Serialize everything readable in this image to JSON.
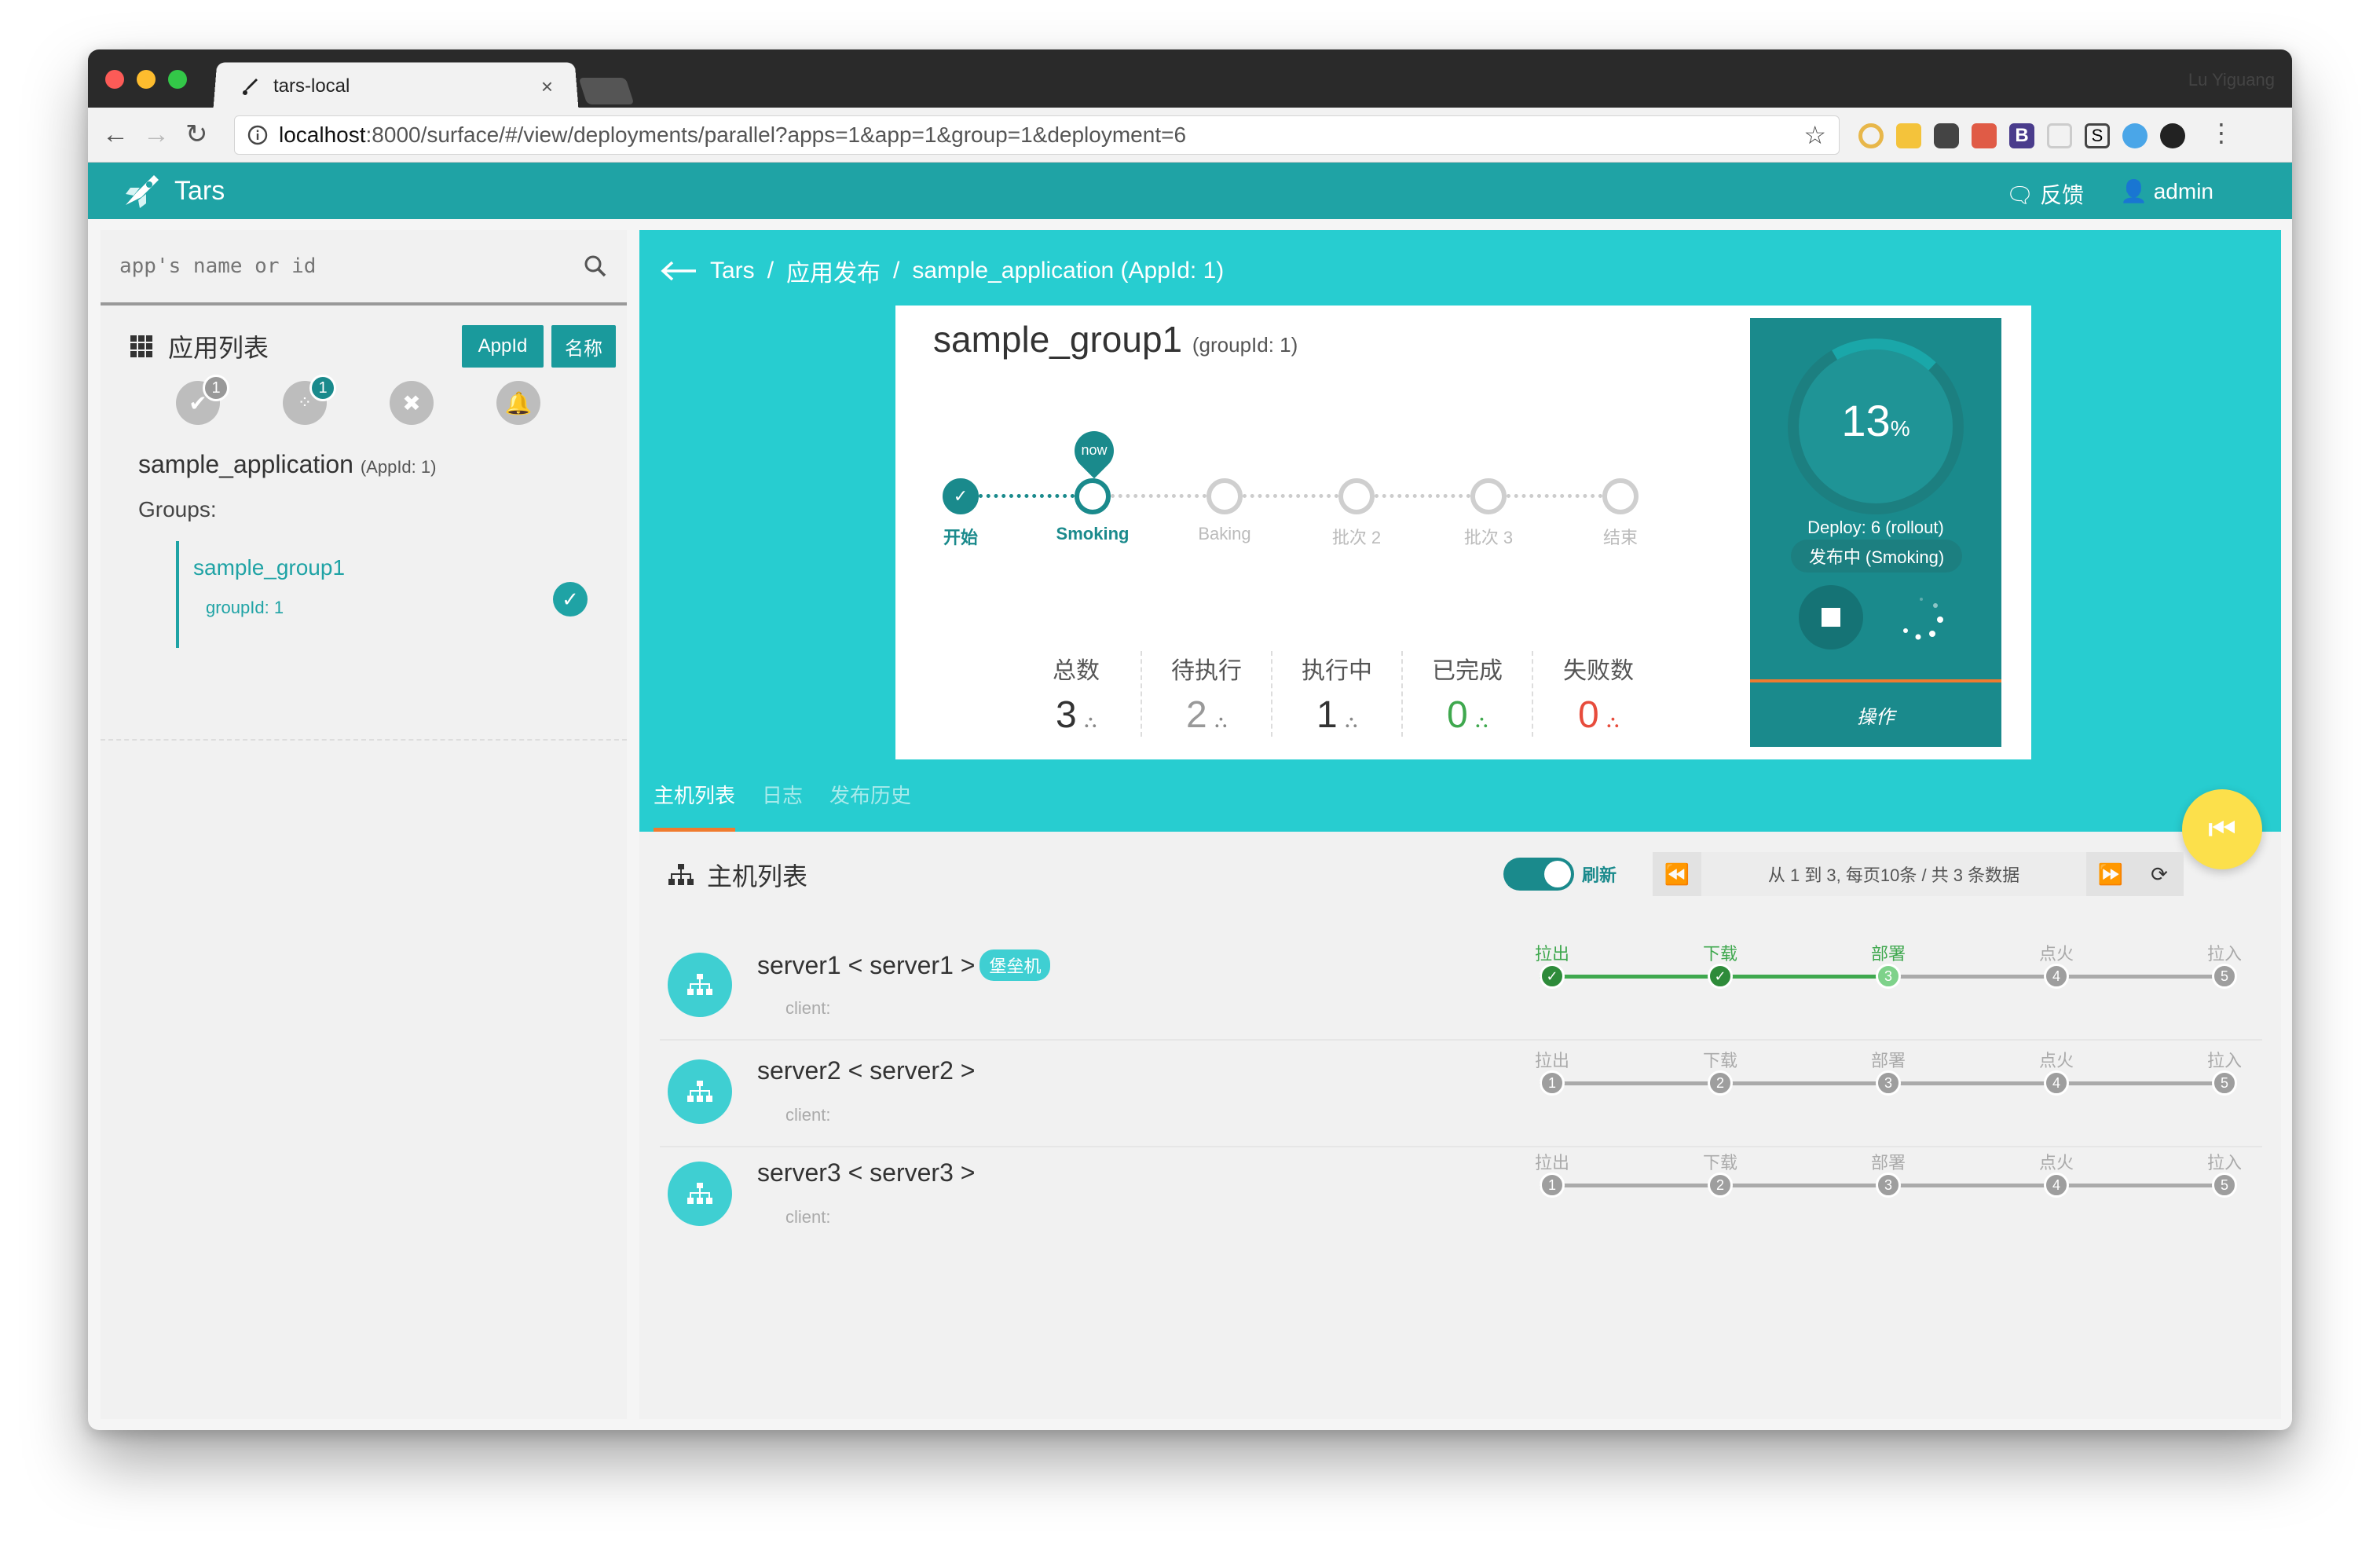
{
  "browser": {
    "tab_title": "tars-local",
    "tab_close": "×",
    "profile_name": "Lu Yiguang",
    "url_host": "localhost",
    "url_rest": ":8000/surface/#/view/deployments/parallel?apps=1&app=1&group=1&deployment=6"
  },
  "app": {
    "brand": "Tars",
    "feedback": "反馈",
    "user": "admin"
  },
  "sidebar": {
    "search_placeholder": "app's name or id",
    "list_title": "应用列表",
    "btn_appid": "AppId",
    "btn_name": "名称",
    "filters": [
      {
        "icon": "check-icon",
        "badge": "1",
        "badge_color": "#999999"
      },
      {
        "icon": "loading-icon",
        "badge": "1",
        "badge_color": "#1a8a8c"
      },
      {
        "icon": "close-icon",
        "badge": "",
        "badge_color": ""
      },
      {
        "icon": "bell-icon",
        "badge": "",
        "badge_color": ""
      }
    ],
    "app_name": "sample_application",
    "app_id_text": "(AppId: 1)",
    "groups_label": "Groups:",
    "group_name": "sample_group1",
    "group_id_text": "groupId: 1"
  },
  "breadcrumb": {
    "items": [
      "Tars",
      "/",
      "应用发布",
      "/",
      "sample_application (AppId: 1)"
    ]
  },
  "deploy_card": {
    "group_title": "sample_group1",
    "group_id_text": "(groupId: 1)",
    "now_label": "now",
    "steps": [
      "开始",
      "Smoking",
      "Baking",
      "批次 2",
      "批次 3",
      "结束"
    ],
    "stats": [
      {
        "label": "总数",
        "value": "3",
        "color": "#333333"
      },
      {
        "label": "待执行",
        "value": "2",
        "color": "#999999"
      },
      {
        "label": "执行中",
        "value": "1",
        "color": "#333333"
      },
      {
        "label": "已完成",
        "value": "0",
        "color": "#3fa84e"
      },
      {
        "label": "失败数",
        "value": "0",
        "color": "#e74c3c"
      }
    ],
    "progress_value": "13",
    "progress_unit": "%",
    "deploy_text": "Deploy: 6 (rollout)",
    "status_text": "发布中 (Smoking)",
    "operate_label": "操作"
  },
  "tabs": [
    "主机列表",
    "日志",
    "发布历史"
  ],
  "host_list": {
    "title": "主机列表",
    "refresh_label": "刷新",
    "pager_text": "从 1 到 3, 每页10条 / 共 3 条数据",
    "stage_labels": [
      "拉出",
      "下载",
      "部署",
      "点火",
      "拉入"
    ],
    "servers": [
      {
        "name": "server1 < server1 >",
        "tag": "堡垒机",
        "client": "client:",
        "completed": 2
      },
      {
        "name": "server2 < server2 >",
        "tag": "",
        "client": "client:",
        "completed": 0
      },
      {
        "name": "server3 < server3 >",
        "tag": "",
        "client": "client:",
        "completed": 0
      }
    ]
  },
  "colors": {
    "accent": "#1fa3a5",
    "hero": "#27cdd0",
    "progress_panel": "#1a8a8c",
    "orange": "#f07b2f",
    "fab": "#fce04b"
  }
}
